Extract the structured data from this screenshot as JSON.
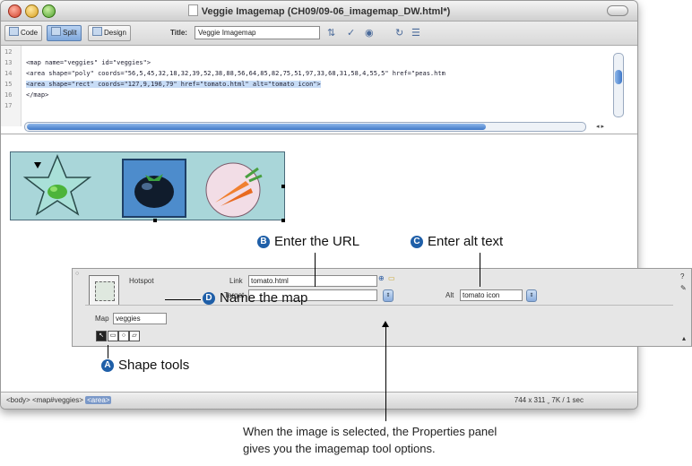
{
  "window": {
    "title": "Veggie Imagemap (CH09/09-06_imagemap_DW.html*)"
  },
  "toolbar": {
    "code_label": "Code",
    "split_label": "Split",
    "design_label": "Design",
    "title_label": "Title:",
    "title_value": "Veggie Imagemap"
  },
  "code_view": {
    "line_numbers": [
      "12",
      "13",
      "14",
      "15",
      "16",
      "17"
    ],
    "lines": [
      "<map name=\"veggies\" id=\"veggies\">",
      "  <area shape=\"poly\" coords=\"56,5,45,32,18,32,39,52,38,88,56,64,85,82,75,51,97,33,68,31,58,4,55,5\" href=\"peas.htm",
      "  <area shape=\"rect\" coords=\"127,9,196,79\" href=\"tomato.html\" alt=\"tomato icon\">",
      "</map>"
    ]
  },
  "properties": {
    "element_type": "Hotspot",
    "link_label": "Link",
    "link_value": "tomato.html",
    "target_label": "Target",
    "target_value": "",
    "alt_label": "Alt",
    "alt_value": "tomato icon",
    "map_label": "Map",
    "map_value": "veggies"
  },
  "status_bar": {
    "tag_body": "<body>",
    "tag_map": "<map#veggies>",
    "tag_area": "<area>",
    "dimensions": "744 x 311 ˬ 7K / 1 sec"
  },
  "callouts": {
    "a_letter": "A",
    "a_text": "Shape tools",
    "b_letter": "B",
    "b_text": "Enter the URL",
    "c_letter": "C",
    "c_text": "Enter alt text",
    "d_letter": "D",
    "d_text": "Name the map",
    "caption_line1": "When the image is selected, the Properties panel",
    "caption_line2": "gives you the imagemap tool options."
  },
  "colors": {
    "badge": "#1f5fa8",
    "image_bg": "#a9d6d9",
    "selection": "#c7dcf6"
  }
}
